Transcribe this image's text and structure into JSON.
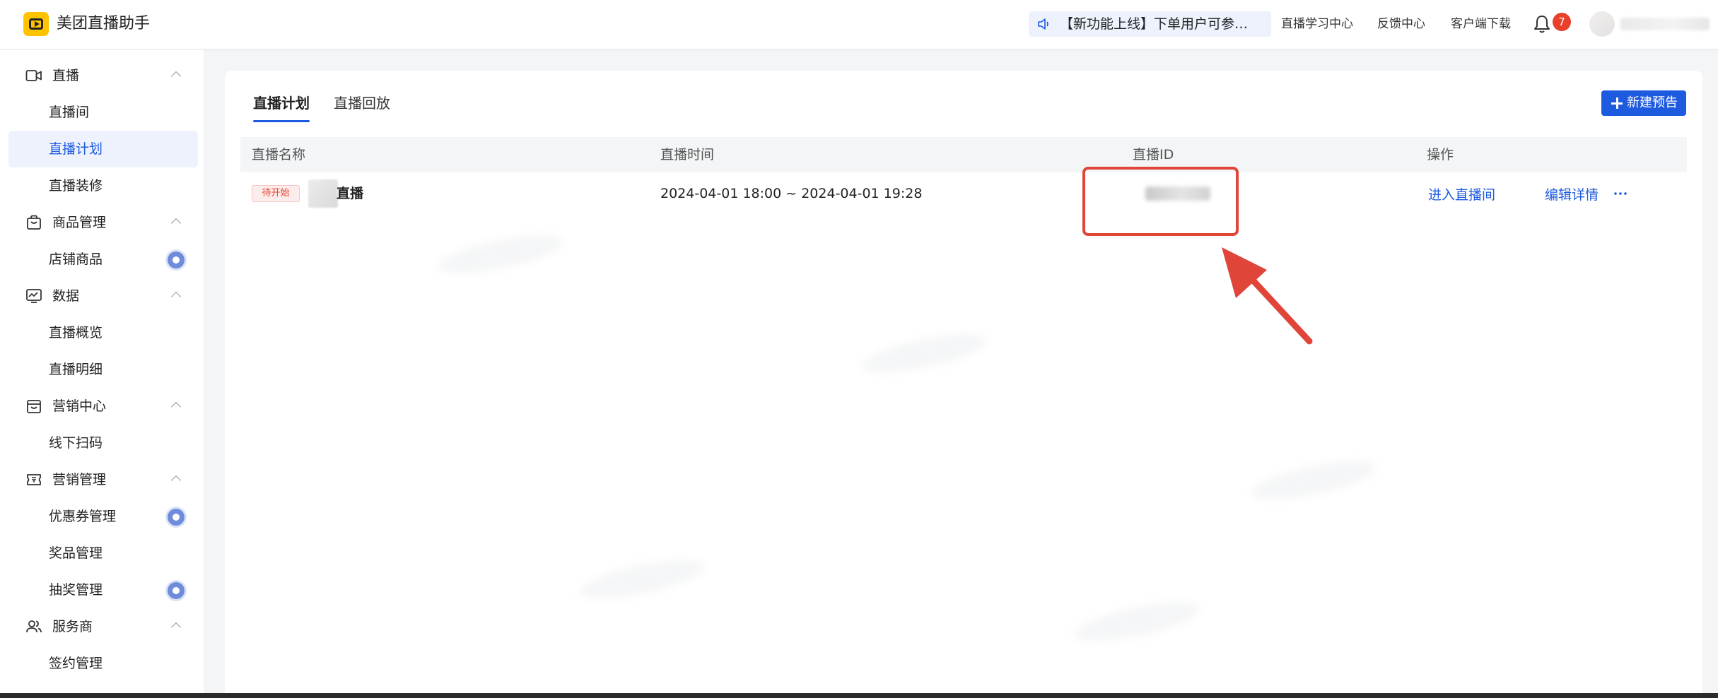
{
  "header": {
    "app_title": "美团直播助手",
    "announcement": "【新功能上线】下单用户可参…",
    "links": [
      "直播学习中心",
      "反馈中心",
      "客户端下载"
    ],
    "notification_count": "7"
  },
  "sidebar": {
    "groups": [
      {
        "label": "直播",
        "icon": "video-camera-icon",
        "items": [
          {
            "label": "直播间"
          },
          {
            "label": "直播计划",
            "active": true
          },
          {
            "label": "直播装修"
          }
        ]
      },
      {
        "label": "商品管理",
        "icon": "shopping-bag-icon",
        "items": [
          {
            "label": "店铺商品",
            "dot": true
          }
        ]
      },
      {
        "label": "数据",
        "icon": "chart-monitor-icon",
        "items": [
          {
            "label": "直播概览"
          },
          {
            "label": "直播明细"
          }
        ]
      },
      {
        "label": "营销中心",
        "icon": "store-icon",
        "items": [
          {
            "label": "线下扫码"
          }
        ]
      },
      {
        "label": "营销管理",
        "icon": "ticket-icon",
        "items": [
          {
            "label": "优惠券管理",
            "dot": true
          },
          {
            "label": "奖品管理"
          },
          {
            "label": "抽奖管理",
            "dot": true
          }
        ]
      },
      {
        "label": "服务商",
        "icon": "users-icon",
        "items": [
          {
            "label": "签约管理"
          }
        ]
      }
    ]
  },
  "main": {
    "tabs": [
      {
        "label": "直播计划",
        "active": true
      },
      {
        "label": "直播回放"
      }
    ],
    "new_button_label": "新建预告",
    "table": {
      "columns": [
        "直播名称",
        "直播时间",
        "直播ID",
        "操作"
      ],
      "rows": [
        {
          "status": "待开始",
          "name": "直播",
          "time": "2024-04-01 18:00 ~ 2024-04-01 19:28",
          "actions": [
            "进入直播间",
            "编辑详情"
          ]
        }
      ]
    }
  },
  "colors": {
    "accent": "#1d5ae0",
    "brand": "#ffc300",
    "highlight": "#e0453a"
  }
}
